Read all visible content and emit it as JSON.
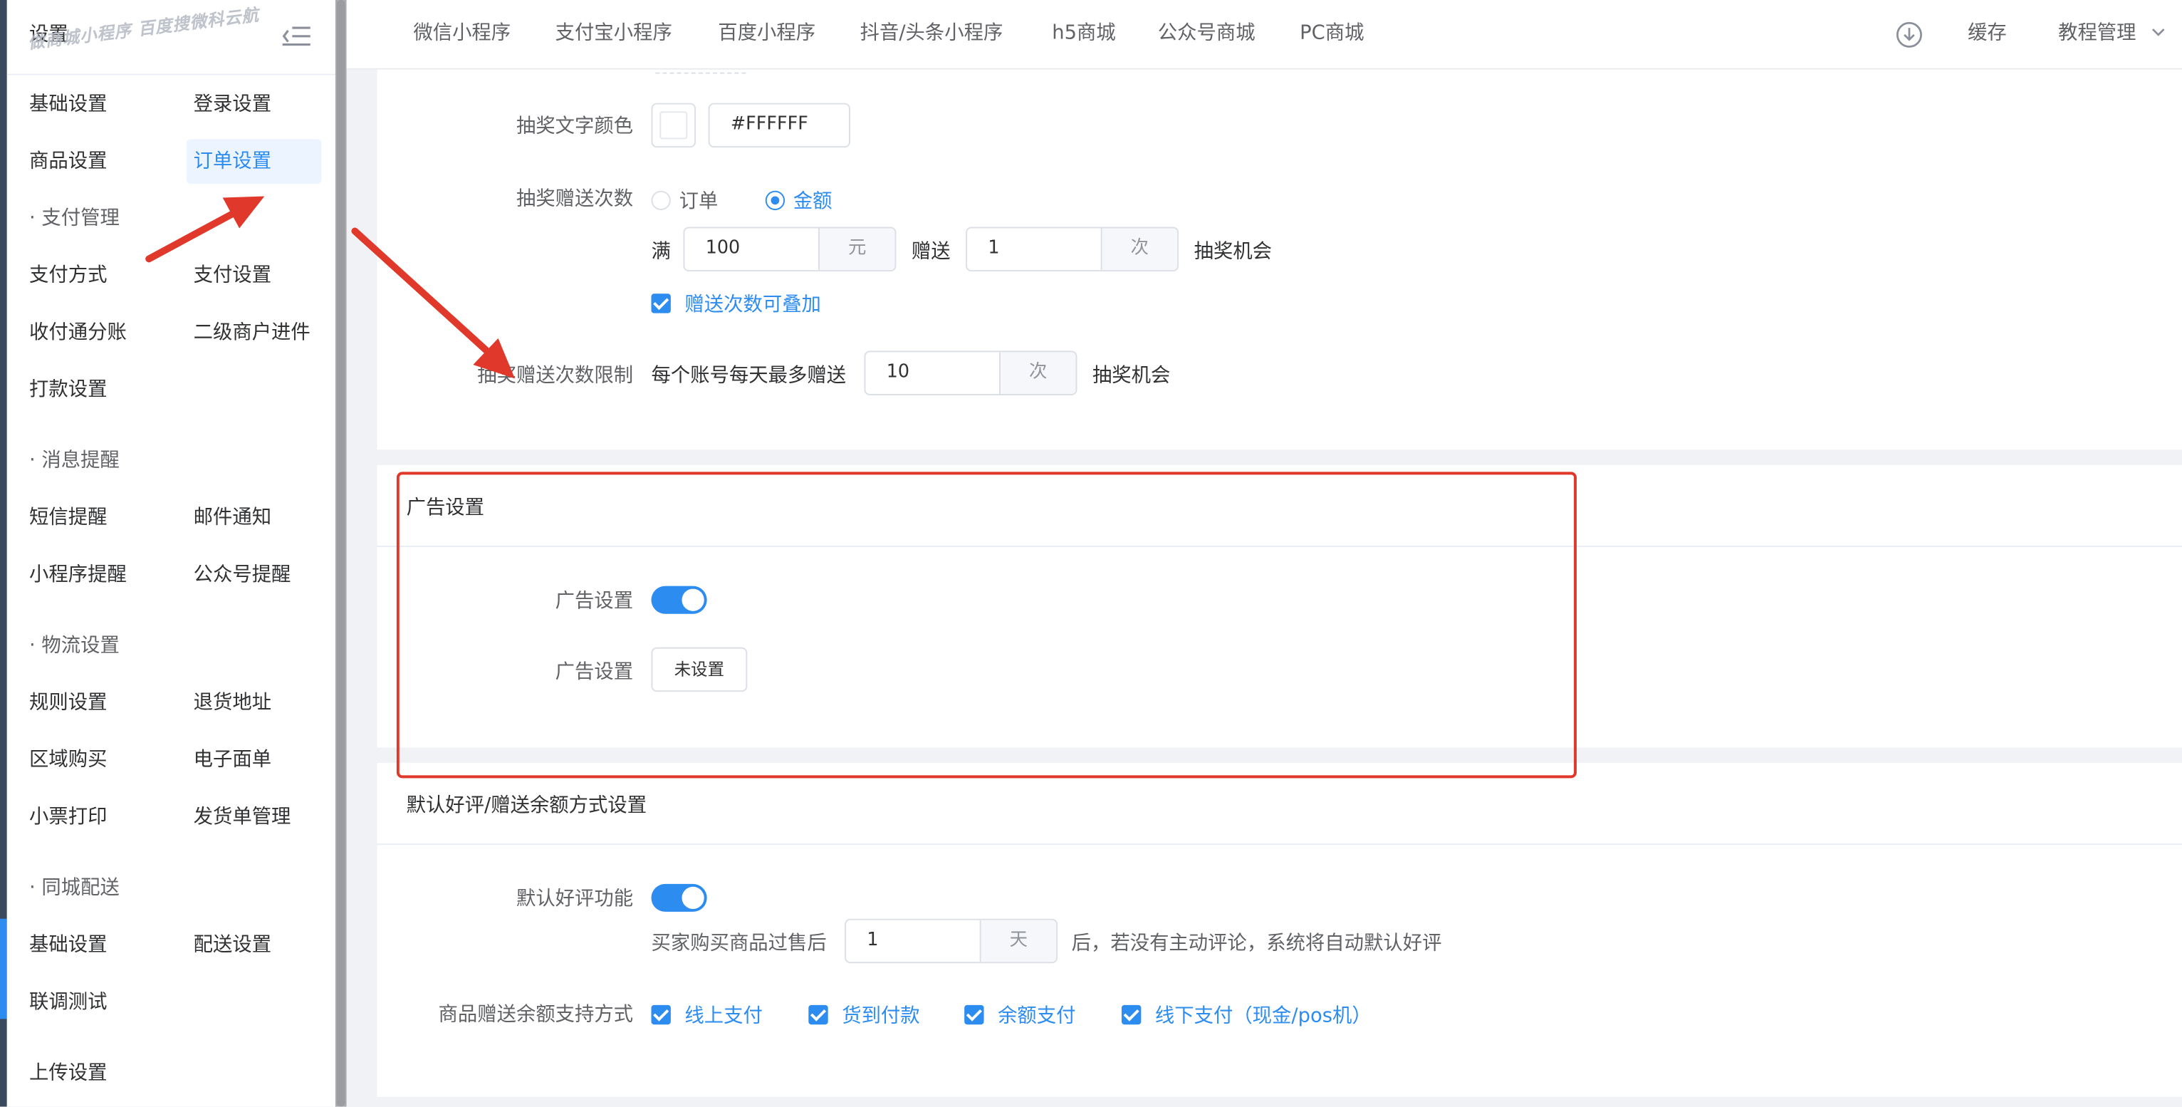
{
  "sidebar": {
    "title": "设置",
    "watermark": "做商城小程序 百度搜微科云航",
    "menu_icon": "menu-fold-icon",
    "items": {
      "basic": "基础设置",
      "login": "登录设置",
      "goods": "商品设置",
      "order": "订单设置",
      "pay_group": "· 支付管理",
      "pay_method": "支付方式",
      "pay_settings": "支付设置",
      "split": "收付通分账",
      "sub_merchant": "二级商户进件",
      "payout": "打款设置",
      "msg_group": "· 消息提醒",
      "sms": "短信提醒",
      "email": "邮件通知",
      "mp_notice": "小程序提醒",
      "oa_notice": "公众号提醒",
      "logistics_group": "· 物流设置",
      "rules": "规则设置",
      "return_addr": "退货地址",
      "region_buy": "区域购买",
      "e_sheet": "电子面单",
      "receipt_print": "小票打印",
      "ship_manage": "发货单管理",
      "city_group": "· 同城配送",
      "city_basic": "基础设置",
      "delivery_settings": "配送设置",
      "joint_test": "联调测试",
      "upload": "上传设置"
    }
  },
  "topnav": {
    "tabs": [
      "微信小程序",
      "支付宝小程序",
      "百度小程序",
      "抖音/头条小程序",
      "h5商城",
      "公众号商城",
      "PC商城"
    ],
    "download_icon": "download-circle-icon",
    "cache": "缓存",
    "tutorial": "教程管理",
    "tutorial_icon": "chevron-down-icon"
  },
  "lottery": {
    "text_color_label": "抽奖文字颜色",
    "text_color_value": "#FFFFFF",
    "gift_count_label": "抽奖赠送次数",
    "option_order": "订单",
    "option_amount": "金额",
    "full_prefix": "满",
    "full_value": "100",
    "full_unit": "元",
    "gift_word": "赠送",
    "gift_value": "1",
    "gift_unit": "次",
    "chance": "抽奖机会",
    "stackable": "赠送次数可叠加",
    "limit_label": "抽奖赠送次数限制",
    "limit_prefix": "每个账号每天最多赠送",
    "limit_value": "10",
    "limit_unit": "次",
    "limit_suffix": "抽奖机会"
  },
  "ad": {
    "section_title": "广告设置",
    "switch_label": "广告设置",
    "button_label": "广告设置",
    "button_text": "未设置",
    "switch_on": true
  },
  "review": {
    "section_title": "默认好评/赠送余额方式设置",
    "default_label": "默认好评功能",
    "after_sale_prefix": "买家购买商品过售后",
    "days_value": "1",
    "days_unit": "天",
    "after_sale_suffix": "后，若没有主动评论，系统将自动默认好评",
    "balance_label": "商品赠送余额支持方式",
    "methods": [
      "线上支付",
      "货到付款",
      "余额支付",
      "线下支付（现金/pos机）"
    ]
  },
  "colors": {
    "accent": "#2d8cf0",
    "annotation": "#e0392b"
  }
}
